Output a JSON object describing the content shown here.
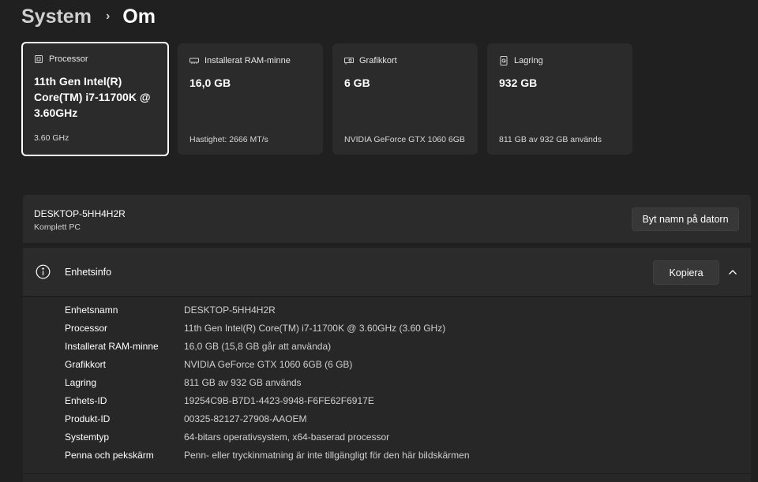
{
  "breadcrumb": {
    "parent": "System",
    "separator": "›",
    "current": "Om"
  },
  "cards": [
    {
      "icon": "processor-icon",
      "label": "Processor",
      "value": "11th Gen Intel(R) Core(TM) i7-11700K @ 3.60GHz",
      "sub": "3.60 GHz"
    },
    {
      "icon": "ram-icon",
      "label": "Installerat RAM-minne",
      "value": "16,0 GB",
      "sub": "Hastighet: 2666 MT/s"
    },
    {
      "icon": "graphics-card-icon",
      "label": "Grafikkort",
      "value": "6 GB",
      "sub": "NVIDIA GeForce GTX 1060 6GB"
    },
    {
      "icon": "storage-icon",
      "label": "Lagring",
      "value": "932 GB",
      "sub": "811 GB av 932 GB används"
    }
  ],
  "device": {
    "name": "DESKTOP-5HH4H2R",
    "model": "Komplett PC",
    "rename_label": "Byt namn på datorn"
  },
  "device_info": {
    "title": "Enhetsinfo",
    "copy_label": "Kopiera",
    "rows": [
      {
        "key": "Enhetsnamn",
        "value": "DESKTOP-5HH4H2R"
      },
      {
        "key": "Processor",
        "value": "11th Gen Intel(R) Core(TM) i7-11700K @ 3.60GHz   (3.60 GHz)"
      },
      {
        "key": "Installerat RAM-minne",
        "value": "16,0 GB (15,8 GB går att använda)"
      },
      {
        "key": "Grafikkort",
        "value": "NVIDIA GeForce GTX 1060 6GB (6 GB)"
      },
      {
        "key": "Lagring",
        "value": "811 GB av 932 GB används"
      },
      {
        "key": "Enhets-ID",
        "value": "19254C9B-B7D1-4423-9948-F6FE62F6917E"
      },
      {
        "key": "Produkt-ID",
        "value": "00325-82127-27908-AAOEM"
      },
      {
        "key": "Systemtyp",
        "value": "64-bitars operativsystem, x64-baserad processor"
      },
      {
        "key": "Penna och pekskärm",
        "value": "Penn- eller tryckinmatning är inte tillgängligt för den här bildskärmen"
      }
    ]
  }
}
